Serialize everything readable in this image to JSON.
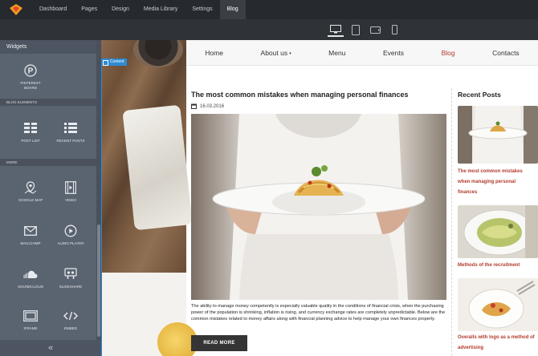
{
  "topbar": {
    "nav": [
      "Dashboard",
      "Pages",
      "Design",
      "Media Library",
      "Settings",
      "Blog"
    ],
    "active": "Blog"
  },
  "devices": [
    "desktop-icon",
    "tablet-portrait-icon",
    "tablet-landscape-icon",
    "phone-icon"
  ],
  "sidebar": {
    "header": "Widgets",
    "pinterest_label": "PINTEREST BOARD",
    "sections": {
      "blog_elements": "BLOG ELEMENTS",
      "more": "MORE"
    },
    "blog_widgets": [
      "POST LIST",
      "RECENT POSTS"
    ],
    "more_widgets": [
      "GOOGLE MAP",
      "VIDEO",
      "MAILCHIMP",
      "AUDIO PLAYER",
      "SOUNDCLOUD",
      "SLIDESHARE",
      "IFRAME",
      "EMBED"
    ],
    "collapse": "«"
  },
  "site": {
    "menu": [
      "Home",
      "About us",
      "Menu",
      "Events",
      "Blog",
      "Contacts"
    ],
    "content_tag": "Content",
    "post": {
      "title": "The most common mistakes when managing personal finances",
      "date": "16.03.2016",
      "body": "The ability to manage money competently is especially valuable quality in the conditions of financial crisis, when the purchasing power of the population is shrinking, inflation is rising, and currency exchange rates are completely unpredictable. Below are the common mistakes related to money affairs along with financial planning advice to help manage your own finances properly.",
      "read_more": "READ MORE"
    },
    "recent": {
      "title": "Recent Posts",
      "items": [
        "The most common mistakes when managing personal finances",
        "Methods of the recruitment",
        "Overalls with logo as a method of advertising"
      ]
    }
  },
  "colors": {
    "accent": "#b23b2c",
    "selection": "#2d8ad3",
    "sidebar": "#5a6370"
  }
}
